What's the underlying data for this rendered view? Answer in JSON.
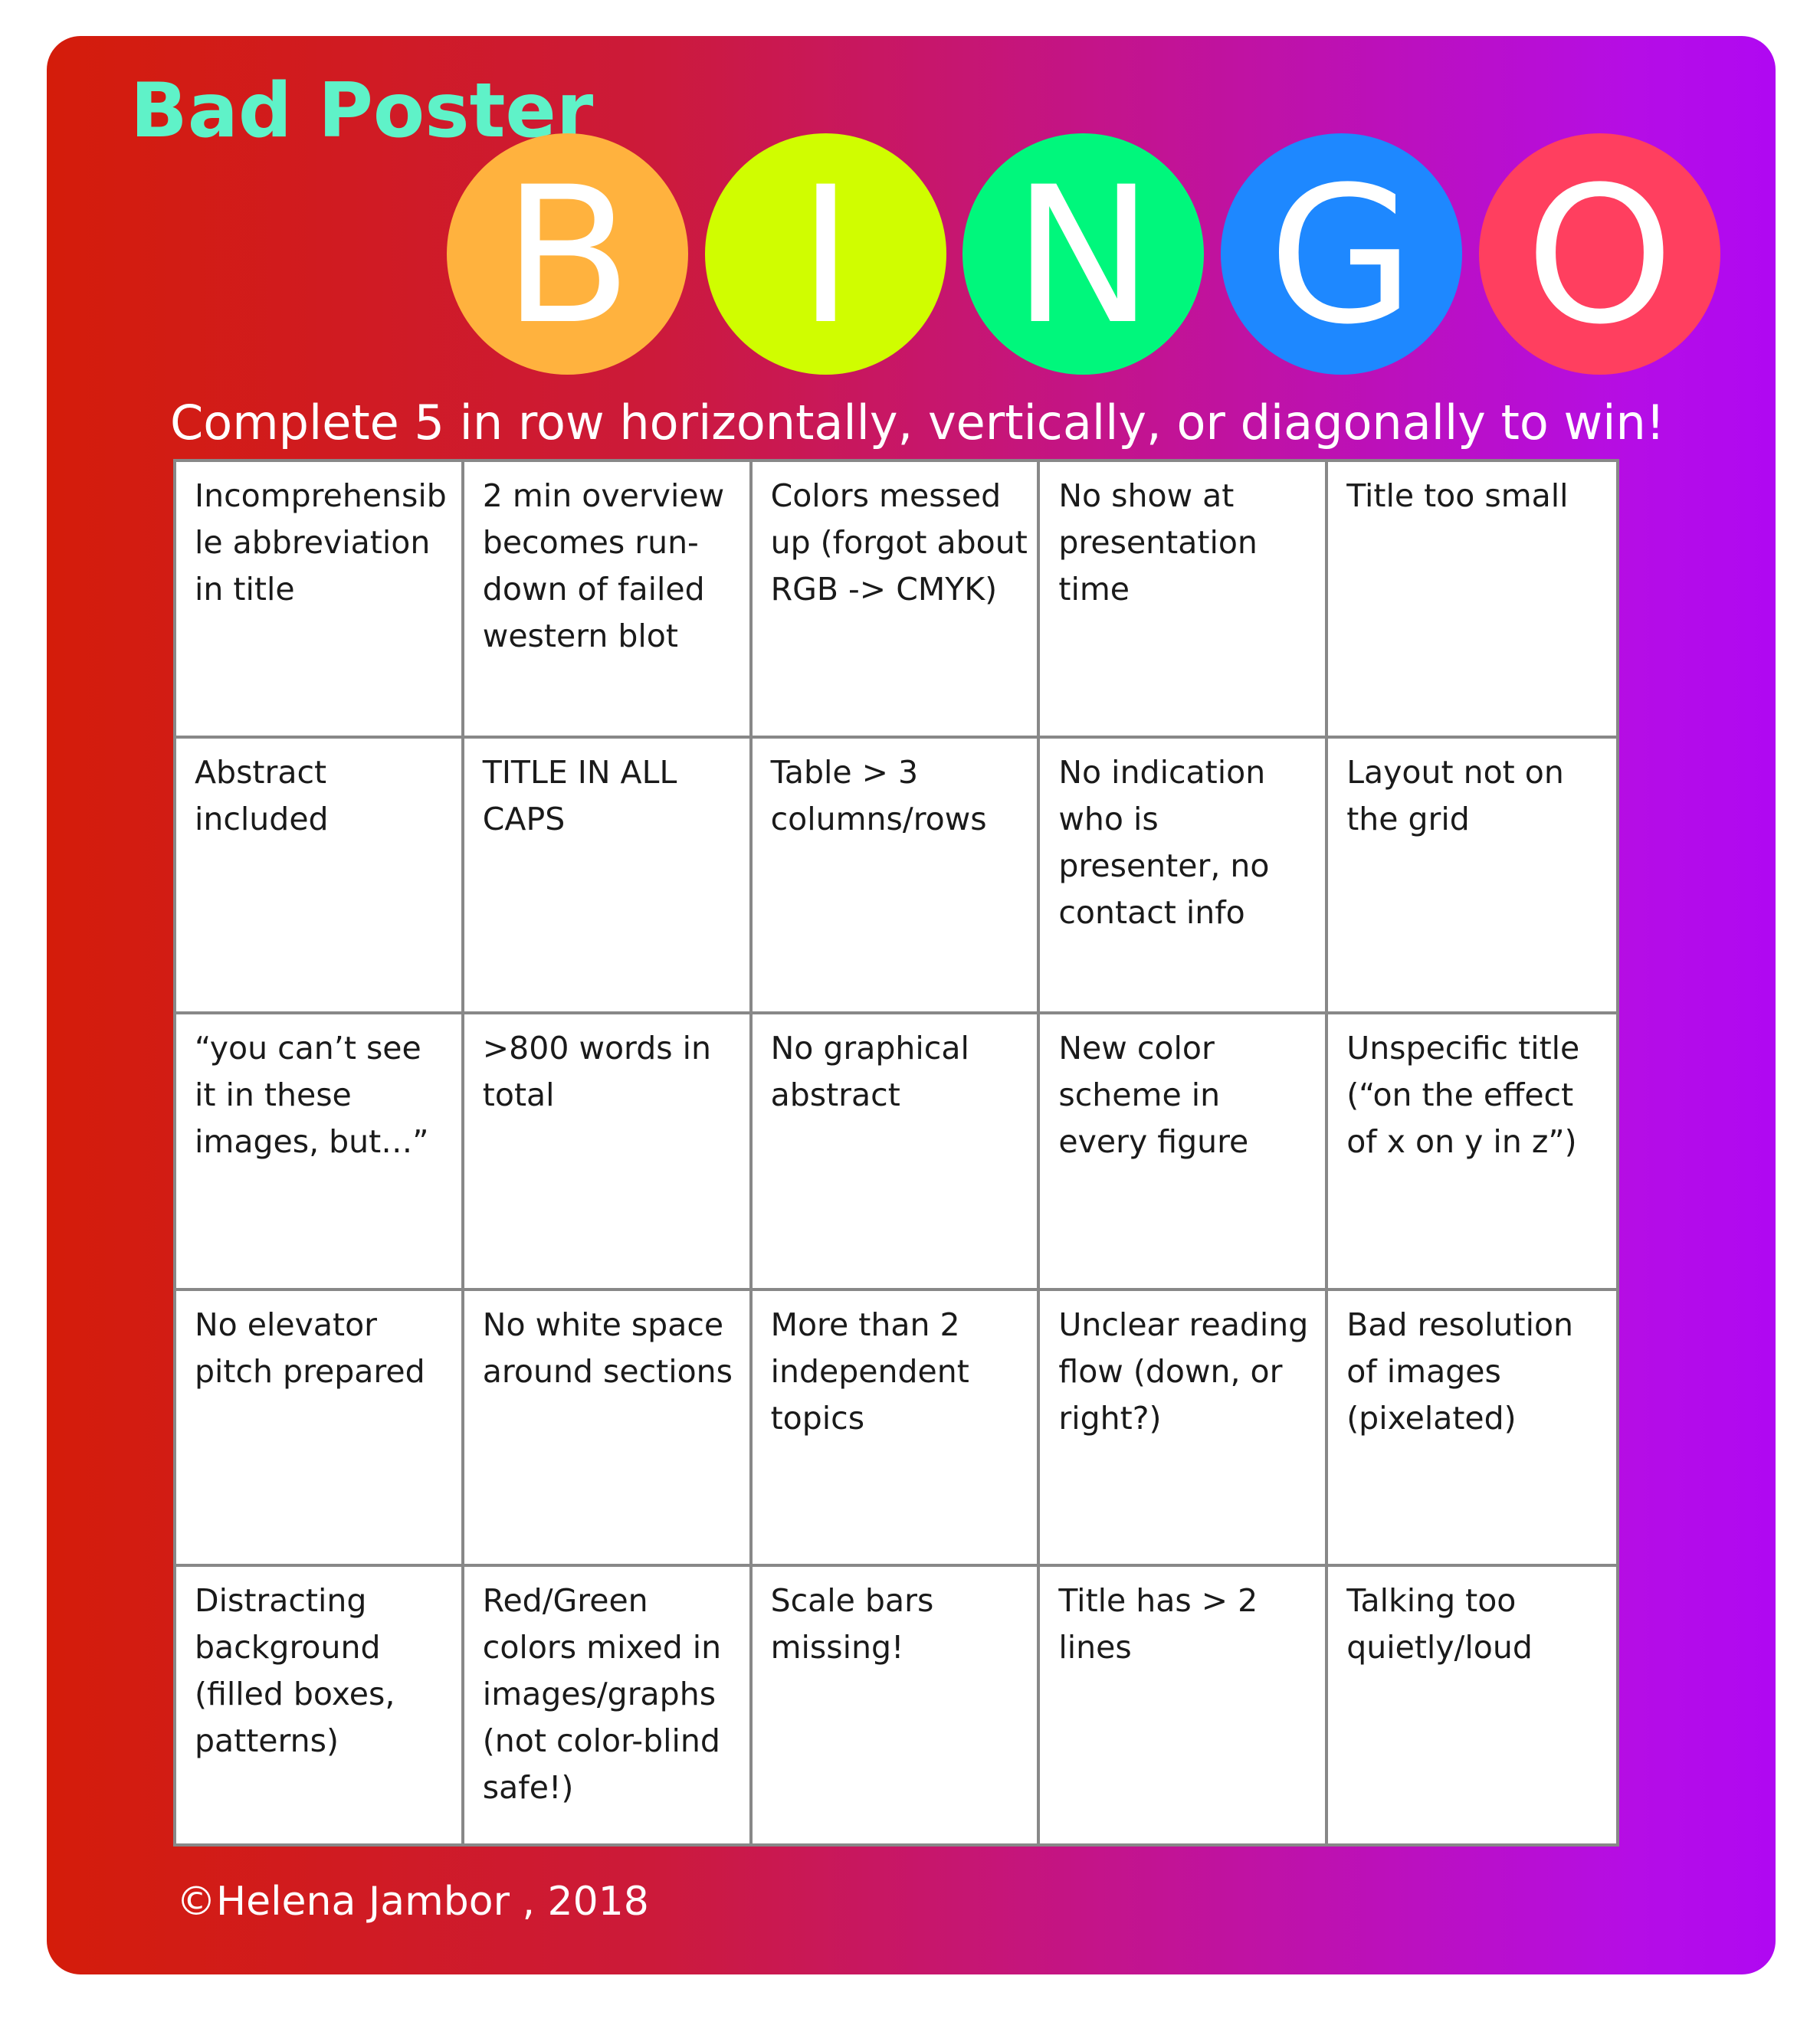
{
  "header": {
    "title": "Bad Poster",
    "title_color": "#5ff2c8"
  },
  "bingo": [
    {
      "letter": "B",
      "color": "#ffb23e"
    },
    {
      "letter": "I",
      "color": "#d0fd00"
    },
    {
      "letter": "N",
      "color": "#00f77c"
    },
    {
      "letter": "G",
      "color": "#1e88ff"
    },
    {
      "letter": "O",
      "color": "#ff3f5f"
    }
  ],
  "instructions": "Complete 5 in row horizontally, vertically, or diagonally to win!",
  "cells": [
    "Incomprehensible abbreviation in title",
    "2 min overview becomes run-down of failed western blot",
    "Colors messed up (forgot about RGB -> CMYK)",
    "No show at presentation time",
    "Title too small",
    "Abstract included",
    "TITLE IN ALL CAPS",
    "Table > 3 columns/rows",
    "No indication who is presenter, no contact info",
    "Layout not on the grid",
    "“you can’t see it in these images, but…”",
    ">800 words in total",
    "No graphical abstract",
    "New color scheme in every figure",
    "Unspecific title (“on the effect of x on y in z”)",
    "No elevator pitch prepared",
    "No white space around sections",
    "More than 2 independent topics",
    "Unclear reading flow (down, or right?)",
    "Bad resolution of images (pixelated)",
    "Distracting background (filled boxes, patterns)",
    "Red/Green colors mixed in images/graphs (not color-blind safe!)",
    "Scale bars missing!",
    "Title has > 2 lines",
    "Talking too quietly/loud"
  ],
  "footer": {
    "copyright": "©Helena Jambor , 2018"
  },
  "colors": {
    "gradient_left": "#d41c0a",
    "gradient_right": "#b008f2",
    "grid_border": "#888888"
  }
}
